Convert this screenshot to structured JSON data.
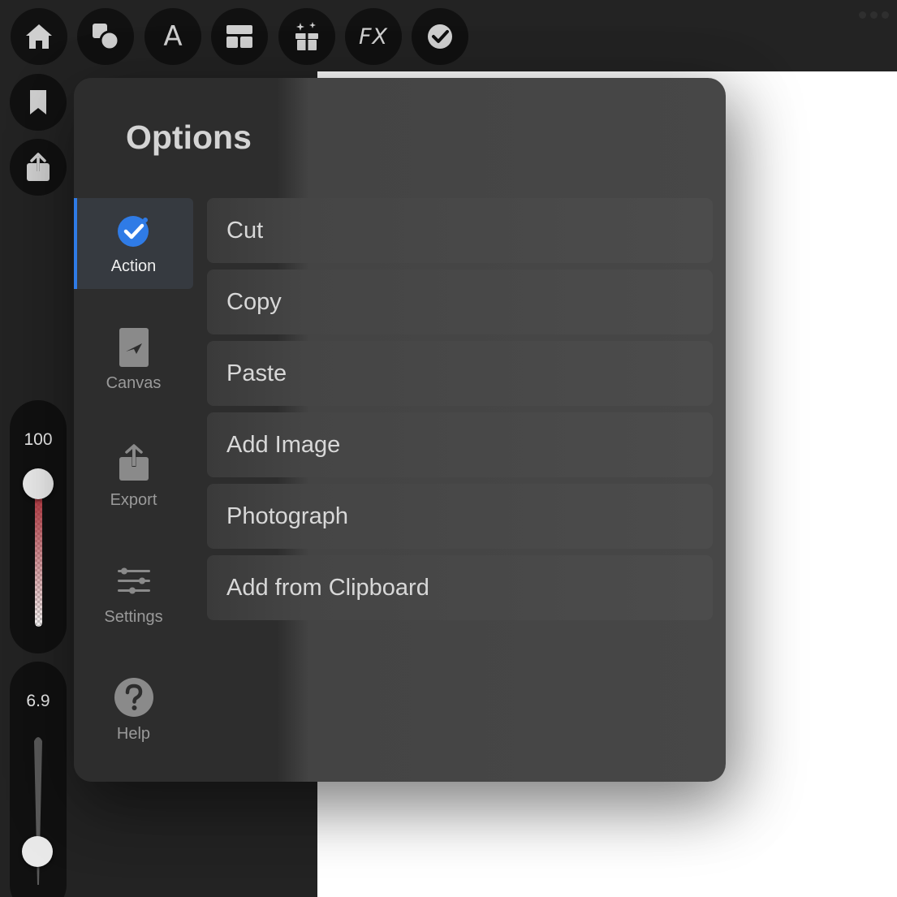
{
  "toolbar": {
    "fx_label": "FX",
    "text_tool_glyph": "A",
    "icons": [
      "home-icon",
      "shapes-icon",
      "text-icon",
      "layout-icon",
      "gift-sparkle-icon",
      "fx-icon",
      "checkmark-badge-icon"
    ]
  },
  "sidebar": {
    "opacity_value": "100",
    "opacity_level": 1.0,
    "size_value": "6.9",
    "size_level": 0.069
  },
  "options": {
    "title": "Options",
    "tabs": [
      {
        "label": "Action",
        "icon": "action-check-icon",
        "active": true
      },
      {
        "label": "Canvas",
        "icon": "canvas-icon",
        "active": false
      },
      {
        "label": "Export",
        "icon": "export-icon",
        "active": false
      },
      {
        "label": "Settings",
        "icon": "sliders-icon",
        "active": false
      },
      {
        "label": "Help",
        "icon": "help-icon",
        "active": false
      }
    ],
    "items": [
      "Cut",
      "Copy",
      "Paste",
      "Add Image",
      "Photograph",
      "Add from Clipboard"
    ]
  },
  "colors": {
    "accent": "#2f7be6",
    "panel": "#474747",
    "toolbar": "#232323",
    "canvas": "#ffffff"
  }
}
